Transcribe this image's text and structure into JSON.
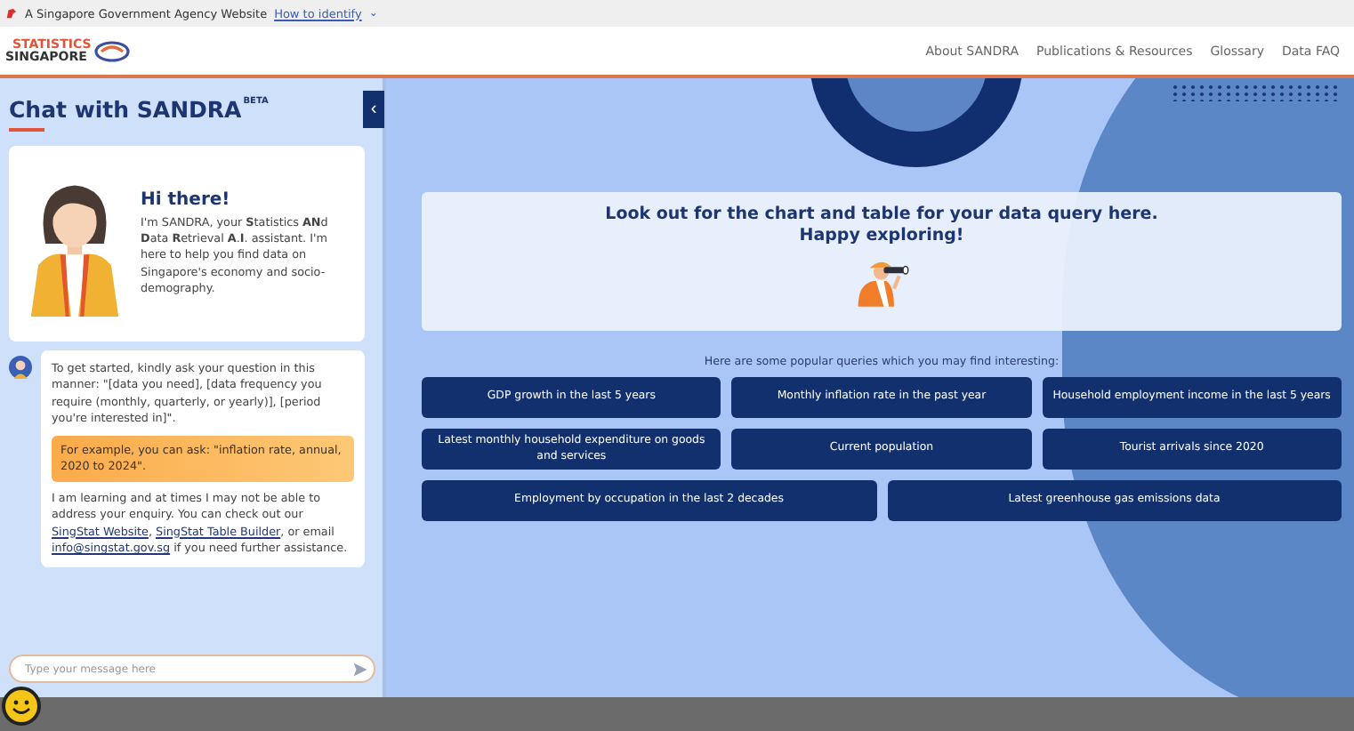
{
  "gov_banner": {
    "text": "A Singapore Government Agency Website",
    "link": "How to identify",
    "caret": "⌄"
  },
  "header": {
    "logo": {
      "line_1": "STATISTICS",
      "line_2": "SINGAPORE"
    },
    "nav": [
      {
        "label": "About SANDRA"
      },
      {
        "label": "Publications & Resources"
      },
      {
        "label": "Glossary"
      },
      {
        "label": "Data FAQ"
      }
    ]
  },
  "chat": {
    "title": "Chat with SANDRA",
    "title_badge": "BETA",
    "collapse": "‹",
    "greeting": {
      "heading": "Hi there!",
      "text": "I'm SANDRA, your **S**tatistics **AN**d **D**ata **R**etrieval **A**.**I**. assistant. I'm here to help you find data on Singapore's economy and socio-demography."
    },
    "message": {
      "intro": "To get started, kindly ask your question in this manner: \"[data you need], [data frequency you require (monthly, quarterly, or yearly)], [period you're interested in]\".",
      "example": "For example, you can ask: \"inflation rate, annual, 2020 to 2024\".",
      "closing": [
        {
          "kind": "text",
          "text": "I am learning and at times I may not be able to address your enquiry. You can check out our "
        },
        {
          "kind": "link",
          "text": "SingStat Website"
        },
        {
          "kind": "text",
          "text": ", "
        },
        {
          "kind": "link",
          "text": "SingStat Table Builder"
        },
        {
          "kind": "text",
          "text": ", or email "
        },
        {
          "kind": "link",
          "text": "info@singstat.gov.sg"
        },
        {
          "kind": "text",
          "text": " if you need further assistance."
        }
      ]
    },
    "input": {
      "placeholder": "Type your message here"
    }
  },
  "results": {
    "heading": "Look out for the chart and table for your data query here.",
    "subheading": "Happy exploring!",
    "queries_intro": "Here are some popular queries which you may find interesting:",
    "query_rows": [
      [
        "GDP growth in the last 5 years",
        "Monthly inflation rate in the past year",
        "Household employment income in the last 5 years"
      ],
      [
        "Latest monthly household expenditure on goods and services",
        "Current population",
        "Tourist arrivals since 2020"
      ],
      [
        "Employment by occupation in the last 2 decades",
        "Latest greenhouse gas emissions data"
      ]
    ]
  }
}
